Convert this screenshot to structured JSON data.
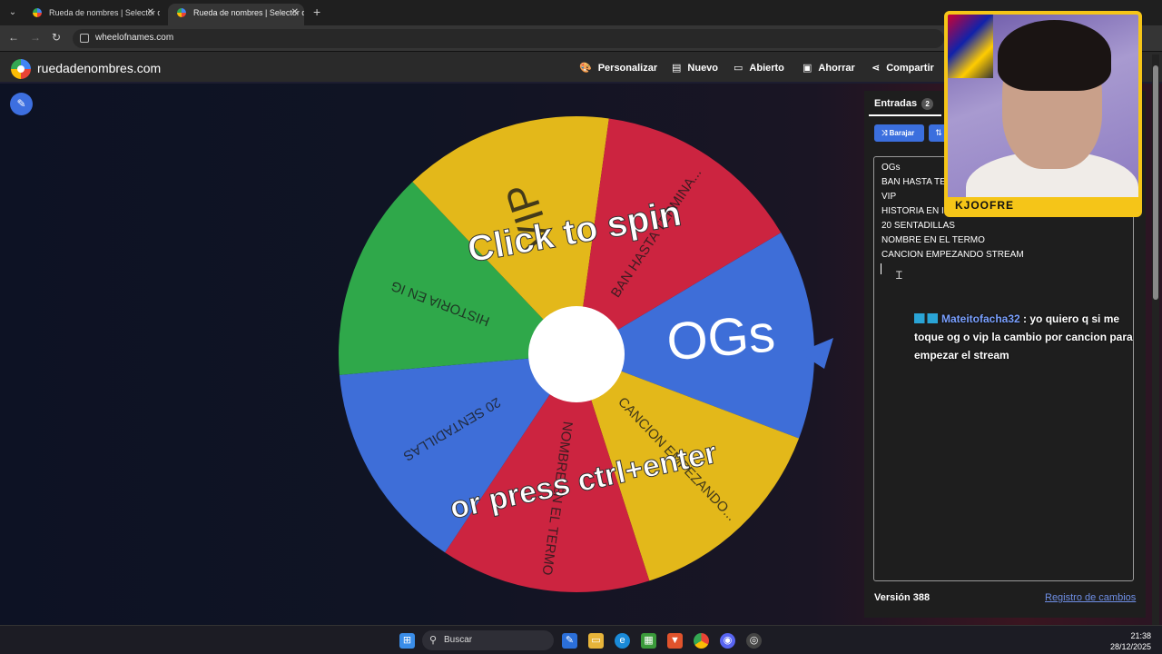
{
  "browser": {
    "tabs": [
      {
        "title": "Rueda de nombres | Selector de",
        "active": false
      },
      {
        "title": "Rueda de nombres | Selector de",
        "active": true
      }
    ],
    "url": "wheelofnames.com"
  },
  "header": {
    "brand": "ruedadenombres.com",
    "nav": [
      "Personalizar",
      "Nuevo",
      "Abierto",
      "Ahorrar",
      "Compartir"
    ]
  },
  "wheel": {
    "overlay_top": "Click to spin",
    "overlay_bottom": "or press ctrl+enter",
    "segments": [
      {
        "label": "OGs",
        "color": "#3e6ed8"
      },
      {
        "label": "CANCION EMPEZANDO...",
        "color": "#e3b81a"
      },
      {
        "label": "NOMBRE EN EL TERMO",
        "color": "#cc2440"
      },
      {
        "label": "20 SENTADILLAS",
        "color": "#3e6ed8"
      },
      {
        "label": "HISTORIA EN IG",
        "color": "#2fa84a"
      },
      {
        "label": "VIP",
        "color": "#e3b81a"
      },
      {
        "label": "BAN HASTA TERMINA...",
        "color": "#cc2440"
      }
    ],
    "pointer_color": "#3e6ed8"
  },
  "sidebar": {
    "tab_label": "Entradas",
    "count": "2",
    "shuffle_label": "Barajar",
    "entries": [
      "OGs",
      "BAN HASTA TE",
      "VIP",
      "HISTORIA EN I",
      "20 SENTADILLAS",
      "NOMBRE EN EL TERMO",
      "CANCION EMPEZANDO STREAM"
    ],
    "version": "Versión 388",
    "changelog": "Registro de cambios"
  },
  "chat": {
    "user": "Mateitofacha32",
    "message": ": yo quiero q si me toque og o vip la cambio por cancion para empezar el stream"
  },
  "webcam": {
    "name_tag": "KJOOFRE"
  },
  "taskbar": {
    "search_label": "Buscar",
    "time": "21:38",
    "date": "28/12/2025"
  }
}
